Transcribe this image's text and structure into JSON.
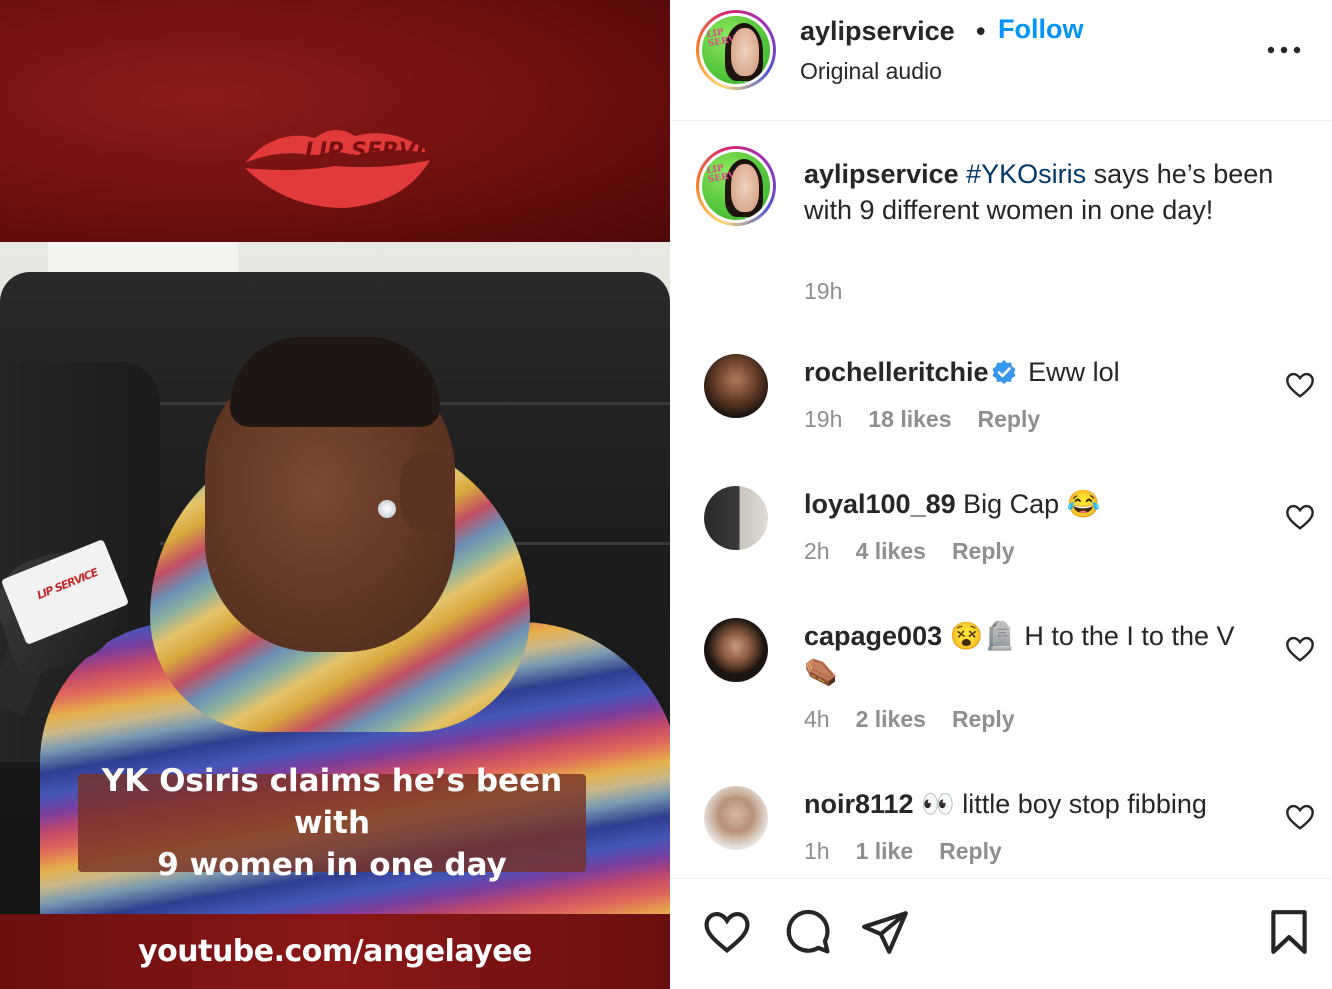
{
  "media": {
    "logo_text": "LIP SERVICE",
    "mic_flag_text": "LIP SERVICE",
    "caption_overlay": "YK Osiris claims he’s been with\n9 women in one day",
    "footer_url": "youtube.com/angelayee",
    "colors": {
      "brand_red": "#8c1717",
      "caption_bg": "#783226"
    }
  },
  "header": {
    "username": "aylipservice",
    "separator": "•",
    "follow_label": "Follow",
    "subtitle": "Original audio",
    "avatar_tag": "LIP SERVICE",
    "more_icon": "more-horizontal-icon"
  },
  "caption": {
    "username": "aylipservice",
    "hashtag": "#YKOsiris",
    "text": " says he’s been with 9 different women in one day!",
    "time": "19h"
  },
  "comments": [
    {
      "username": "rochelleritchie",
      "verified": true,
      "text": "Eww lol",
      "time": "19h",
      "likes": "18 likes",
      "reply": "Reply"
    },
    {
      "username": "loyal100_89",
      "verified": false,
      "text": "Big Cap 😂",
      "time": "2h",
      "likes": "4 likes",
      "reply": "Reply"
    },
    {
      "username": "capage003",
      "verified": false,
      "text": "😵🪦 H to the I to the V ⚰️",
      "time": "4h",
      "likes": "2 likes",
      "reply": "Reply"
    },
    {
      "username": "noir8112",
      "verified": false,
      "text": "👀 little boy stop fibbing",
      "time": "1h",
      "likes": "1 like",
      "reply": "Reply"
    }
  ],
  "actions": {
    "like_icon": "heart-icon",
    "comment_icon": "comment-bubble-icon",
    "share_icon": "paper-plane-icon",
    "save_icon": "bookmark-icon"
  },
  "colors": {
    "link_blue": "#0095f6",
    "hashtag_blue": "#00376b",
    "muted": "#8e8e8e",
    "text": "#262626",
    "verified_blue": "#3897f0"
  }
}
